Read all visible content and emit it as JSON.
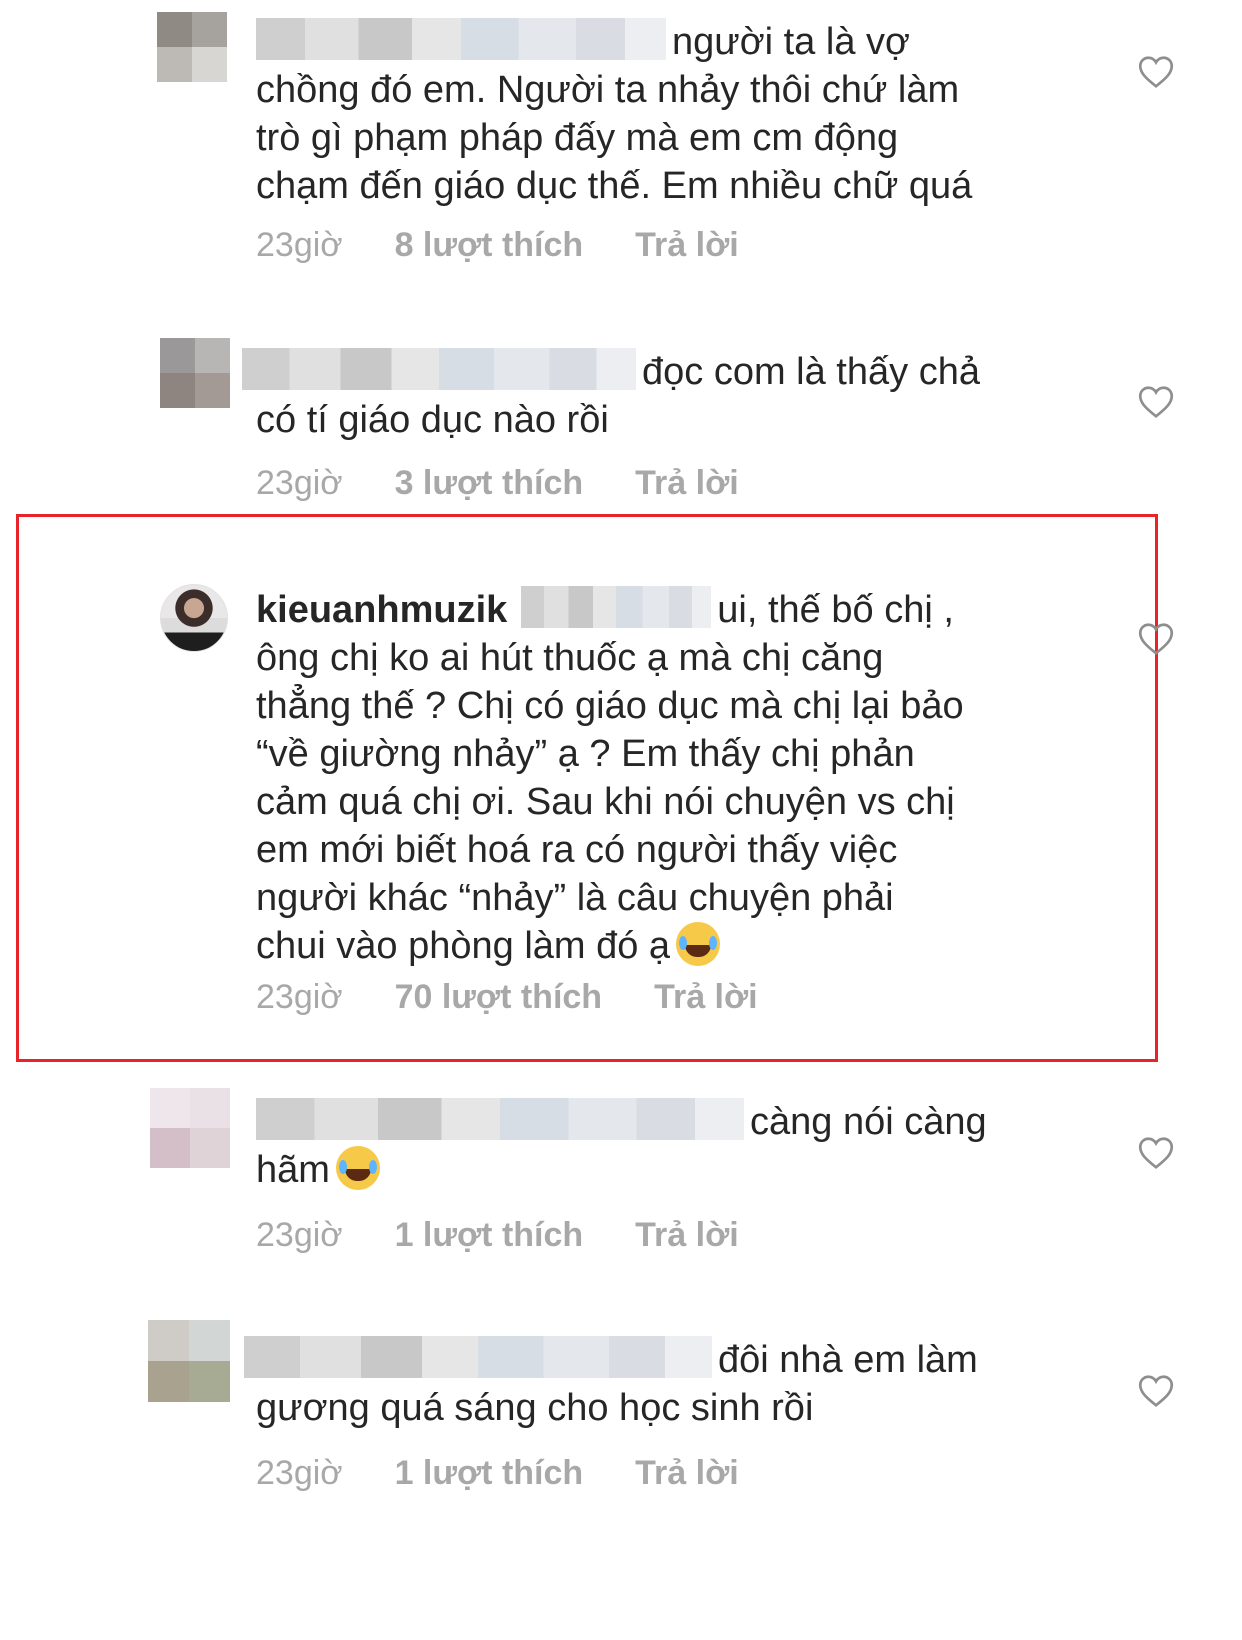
{
  "comments": [
    {
      "username": "",
      "text_lines": [
        "người ta là vợ",
        "chồng đó em. Người ta nhảy thôi chứ làm",
        "trò gì phạm pháp đấy mà em cm động",
        "chạm đến giáo dục thế. Em nhiều chữ quá"
      ],
      "time": "23giờ",
      "likes": "8 lượt thích",
      "reply": "Trả lời"
    },
    {
      "username": "",
      "text_lines": [
        "đọc com là thấy chả",
        "có tí giáo dục nào rồi"
      ],
      "time": "23giờ",
      "likes": "3 lượt thích",
      "reply": "Trả lời"
    },
    {
      "username": "kieuanhmuzik",
      "text_lines": [
        "ui, thế bố chị ,",
        "ông chị ko ai hút thuốc ạ mà chị căng",
        "thẳng thế ? Chị có giáo dục mà chị lại bảo",
        "“về giường nhảy” ạ ? Em thấy chị phản",
        "cảm quá chị ơi. Sau khi nói chuyện vs chị",
        "em mới biết hoá ra có người thấy việc",
        "người khác “nhảy” là câu chuyện phải",
        "chui vào phòng làm đó ạ"
      ],
      "time": "23giờ",
      "likes": "70 lượt thích",
      "reply": "Trả lời",
      "highlighted": true
    },
    {
      "username": "",
      "text_lines": [
        "càng nói càng",
        "hãm"
      ],
      "time": "23giờ",
      "likes": "1 lượt thích",
      "reply": "Trả lời"
    },
    {
      "username": "",
      "text_lines": [
        "đôi nhà em làm",
        "gương quá sáng cho học sinh rồi"
      ],
      "time": "23giờ",
      "likes": "1 lượt thích",
      "reply": "Trả lời"
    }
  ],
  "icons": {
    "like": "heart-outline-icon",
    "emoji": "face-with-tears-of-joy-icon"
  },
  "colors": {
    "text": "#262626",
    "meta": "#a8a8a8",
    "highlight_border": "#e8232a"
  }
}
